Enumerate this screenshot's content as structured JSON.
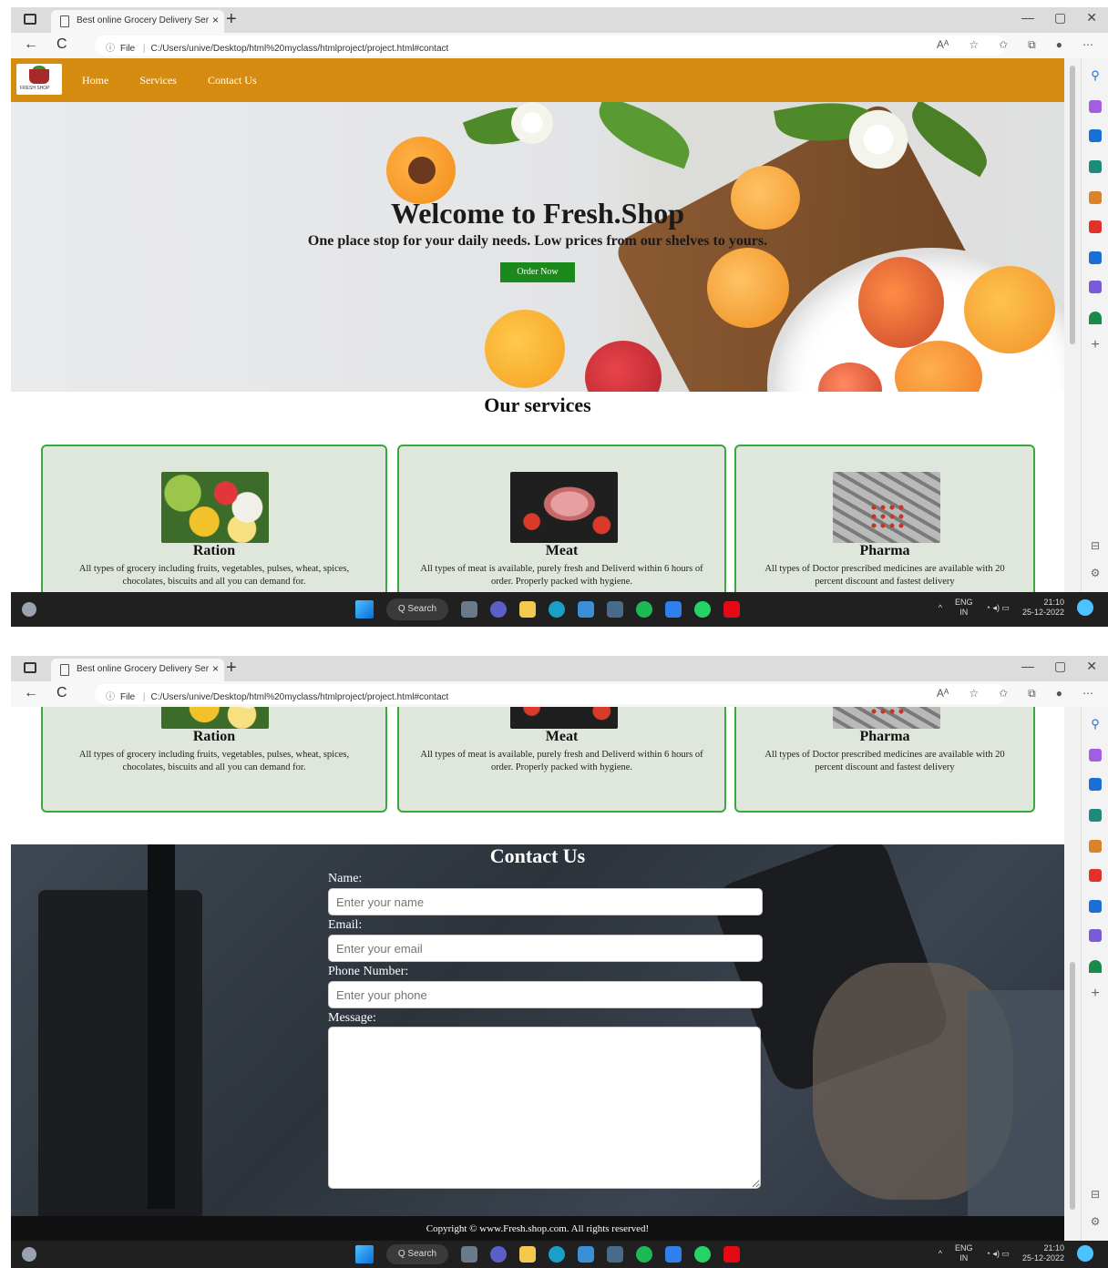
{
  "browser": {
    "tab_title": "Best online Grocery Delivery Ser",
    "tab_close": "×",
    "new_tab": "+",
    "back": "←",
    "reload": "C",
    "info_icon": "ⓘ",
    "file_label": "File",
    "separator": "|",
    "url": "C:/Users/unive/Desktop/html%20myclass/htmlproject/project.html#contact",
    "window_controls": [
      "—",
      "▢",
      "✕"
    ]
  },
  "nav": {
    "logo_text": "FRESH SHOP",
    "links": [
      "Home",
      "Services",
      "Contact Us"
    ]
  },
  "hero": {
    "title": "Welcome to Fresh.Shop",
    "subtitle": "One place stop for your daily needs. Low prices from our shelves to yours.",
    "order_button": "Order Now"
  },
  "services": {
    "title": "Our services",
    "items": [
      {
        "name": "Ration",
        "description": "All types of grocery including fruits, vegetables, pulses, wheat, spices, chocolates, biscuits and all you can demand for."
      },
      {
        "name": "Meat",
        "description": "All types of meat is available, purely fresh and Deliverd within 6 hours of order. Properly packed with hygiene."
      },
      {
        "name": "Pharma",
        "description": "All types of Doctor prescribed medicines are available with 20 percent discount and fastest delivery"
      }
    ]
  },
  "contact": {
    "title": "Contact Us",
    "name_label": "Name:",
    "name_placeholder": "Enter your name",
    "email_label": "Email:",
    "email_placeholder": "Enter your email",
    "phone_label": "Phone Number:",
    "phone_placeholder": "Enter your phone",
    "message_label": "Message:"
  },
  "footer": {
    "copyright": "Copyright © www.Fresh.shop.com. All rights reserved!"
  },
  "taskbar": {
    "search": "Q Search",
    "lang_top": "ENG",
    "lang_bottom": "IN",
    "time": "21:10",
    "date": "25-12-2022"
  },
  "colors": {
    "navbar": "#d68c10",
    "order_button": "#1a8a1a",
    "card_border": "#3aa83a",
    "card_bg": "#dfe7dd",
    "footer": "#111111"
  }
}
